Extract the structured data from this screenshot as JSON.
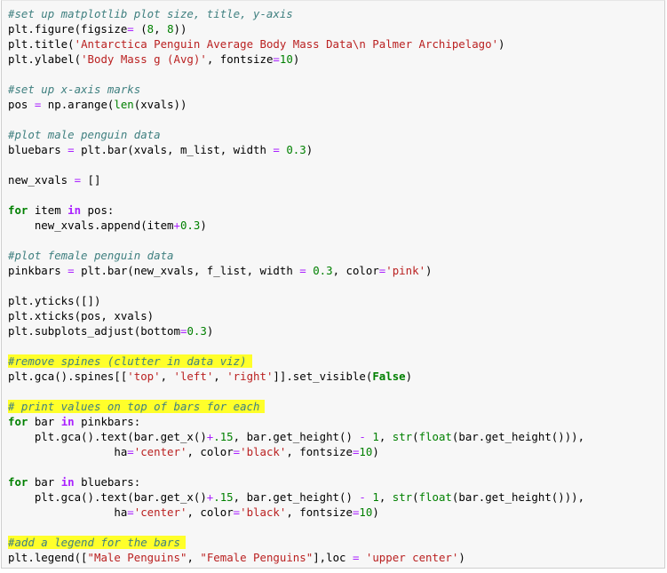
{
  "cell": {
    "type": "code",
    "language": "python",
    "highlight_color": "#ffff2a",
    "lines": [
      {
        "tokens": [
          {
            "t": "#set up matplotlib plot size, title, y-axis",
            "c": "cm"
          }
        ]
      },
      {
        "tokens": [
          {
            "t": "plt.figure(figsize"
          },
          {
            "t": "=",
            "c": "op"
          },
          {
            "t": " ("
          },
          {
            "t": "8",
            "c": "nu"
          },
          {
            "t": ", "
          },
          {
            "t": "8",
            "c": "nu"
          },
          {
            "t": "))"
          }
        ]
      },
      {
        "tokens": [
          {
            "t": "plt.title("
          },
          {
            "t": "'Antarctica Penguin Average Body Mass Data\\n Palmer Archipelago'",
            "c": "st"
          },
          {
            "t": ")"
          }
        ]
      },
      {
        "tokens": [
          {
            "t": "plt.ylabel("
          },
          {
            "t": "'Body Mass g (Avg)'",
            "c": "st"
          },
          {
            "t": ", fontsize"
          },
          {
            "t": "=",
            "c": "op"
          },
          {
            "t": "10",
            "c": "nu"
          },
          {
            "t": ")"
          }
        ]
      },
      {
        "tokens": []
      },
      {
        "tokens": [
          {
            "t": "#set up x-axis marks",
            "c": "cm"
          }
        ]
      },
      {
        "tokens": [
          {
            "t": "pos "
          },
          {
            "t": "=",
            "c": "op"
          },
          {
            "t": " np.arange("
          },
          {
            "t": "len",
            "c": "nb"
          },
          {
            "t": "(xvals))"
          }
        ]
      },
      {
        "tokens": []
      },
      {
        "tokens": [
          {
            "t": "#plot male penguin data",
            "c": "cm"
          }
        ]
      },
      {
        "tokens": [
          {
            "t": "bluebars "
          },
          {
            "t": "=",
            "c": "op"
          },
          {
            "t": " plt.bar(xvals, m_list, width "
          },
          {
            "t": "=",
            "c": "op"
          },
          {
            "t": " "
          },
          {
            "t": "0.3",
            "c": "nu"
          },
          {
            "t": ")"
          }
        ]
      },
      {
        "tokens": []
      },
      {
        "tokens": [
          {
            "t": "new_xvals "
          },
          {
            "t": "=",
            "c": "op"
          },
          {
            "t": " []"
          }
        ]
      },
      {
        "tokens": []
      },
      {
        "tokens": [
          {
            "t": "for",
            "c": "kw"
          },
          {
            "t": " item "
          },
          {
            "t": "in",
            "c": "ow"
          },
          {
            "t": " pos:"
          }
        ]
      },
      {
        "tokens": [
          {
            "t": "    new_xvals.append(item"
          },
          {
            "t": "+",
            "c": "op"
          },
          {
            "t": "0.3",
            "c": "nu"
          },
          {
            "t": ")"
          }
        ]
      },
      {
        "tokens": []
      },
      {
        "tokens": [
          {
            "t": "#plot female penguin data",
            "c": "cm"
          }
        ]
      },
      {
        "tokens": [
          {
            "t": "pinkbars "
          },
          {
            "t": "=",
            "c": "op"
          },
          {
            "t": " plt.bar(new_xvals, f_list, width "
          },
          {
            "t": "=",
            "c": "op"
          },
          {
            "t": " "
          },
          {
            "t": "0.3",
            "c": "nu"
          },
          {
            "t": ", color"
          },
          {
            "t": "=",
            "c": "op"
          },
          {
            "t": "'pink'",
            "c": "st"
          },
          {
            "t": ")"
          }
        ]
      },
      {
        "tokens": []
      },
      {
        "tokens": [
          {
            "t": "plt.yticks([])"
          }
        ]
      },
      {
        "tokens": [
          {
            "t": "plt.xticks(pos, xvals)"
          }
        ]
      },
      {
        "tokens": [
          {
            "t": "plt.subplots_adjust(bottom"
          },
          {
            "t": "=",
            "c": "op"
          },
          {
            "t": "0.3",
            "c": "nu"
          },
          {
            "t": ")"
          }
        ]
      },
      {
        "tokens": []
      },
      {
        "tokens": [
          {
            "t": "#remove spines (clutter in data viz)",
            "c": "cm hl"
          }
        ]
      },
      {
        "tokens": [
          {
            "t": "plt.gca().spines[["
          },
          {
            "t": "'top'",
            "c": "st"
          },
          {
            "t": ", "
          },
          {
            "t": "'left'",
            "c": "st"
          },
          {
            "t": ", "
          },
          {
            "t": "'right'",
            "c": "st"
          },
          {
            "t": "]].set_visible("
          },
          {
            "t": "False",
            "c": "kw"
          },
          {
            "t": ")"
          }
        ]
      },
      {
        "tokens": []
      },
      {
        "tokens": [
          {
            "t": "# print values on top of bars for each",
            "c": "cm hl"
          }
        ]
      },
      {
        "tokens": [
          {
            "t": "for",
            "c": "kw"
          },
          {
            "t": " bar "
          },
          {
            "t": "in",
            "c": "ow"
          },
          {
            "t": " pinkbars:"
          }
        ]
      },
      {
        "tokens": [
          {
            "t": "    plt.gca().text(bar.get_x()"
          },
          {
            "t": "+",
            "c": "op"
          },
          {
            "t": ".15",
            "c": "nu"
          },
          {
            "t": ", bar.get_height() "
          },
          {
            "t": "-",
            "c": "op"
          },
          {
            "t": " "
          },
          {
            "t": "1",
            "c": "nu"
          },
          {
            "t": ", "
          },
          {
            "t": "str",
            "c": "nb"
          },
          {
            "t": "("
          },
          {
            "t": "float",
            "c": "nb"
          },
          {
            "t": "(bar.get_height())),"
          }
        ]
      },
      {
        "tokens": [
          {
            "t": "                ha"
          },
          {
            "t": "=",
            "c": "op"
          },
          {
            "t": "'center'",
            "c": "st"
          },
          {
            "t": ", color"
          },
          {
            "t": "=",
            "c": "op"
          },
          {
            "t": "'black'",
            "c": "st"
          },
          {
            "t": ", fontsize"
          },
          {
            "t": "=",
            "c": "op"
          },
          {
            "t": "10",
            "c": "nu"
          },
          {
            "t": ")"
          }
        ]
      },
      {
        "tokens": []
      },
      {
        "tokens": [
          {
            "t": "for",
            "c": "kw"
          },
          {
            "t": " bar "
          },
          {
            "t": "in",
            "c": "ow"
          },
          {
            "t": " bluebars:"
          }
        ]
      },
      {
        "tokens": [
          {
            "t": "    plt.gca().text(bar.get_x()"
          },
          {
            "t": "+",
            "c": "op"
          },
          {
            "t": ".15",
            "c": "nu"
          },
          {
            "t": ", bar.get_height() "
          },
          {
            "t": "-",
            "c": "op"
          },
          {
            "t": " "
          },
          {
            "t": "1",
            "c": "nu"
          },
          {
            "t": ", "
          },
          {
            "t": "str",
            "c": "nb"
          },
          {
            "t": "("
          },
          {
            "t": "float",
            "c": "nb"
          },
          {
            "t": "(bar.get_height())),"
          }
        ]
      },
      {
        "tokens": [
          {
            "t": "                ha"
          },
          {
            "t": "=",
            "c": "op"
          },
          {
            "t": "'center'",
            "c": "st"
          },
          {
            "t": ", color"
          },
          {
            "t": "=",
            "c": "op"
          },
          {
            "t": "'black'",
            "c": "st"
          },
          {
            "t": ", fontsize"
          },
          {
            "t": "=",
            "c": "op"
          },
          {
            "t": "10",
            "c": "nu"
          },
          {
            "t": ")"
          }
        ]
      },
      {
        "tokens": []
      },
      {
        "tokens": [
          {
            "t": "#add a legend for the bars",
            "c": "cm hl"
          }
        ]
      },
      {
        "tokens": [
          {
            "t": "plt.legend(["
          },
          {
            "t": "\"Male Penguins\"",
            "c": "st"
          },
          {
            "t": ", "
          },
          {
            "t": "\"Female Penguins\"",
            "c": "st"
          },
          {
            "t": "],loc "
          },
          {
            "t": "=",
            "c": "op"
          },
          {
            "t": " "
          },
          {
            "t": "'upper center'",
            "c": "st"
          },
          {
            "t": ")"
          }
        ]
      }
    ]
  }
}
